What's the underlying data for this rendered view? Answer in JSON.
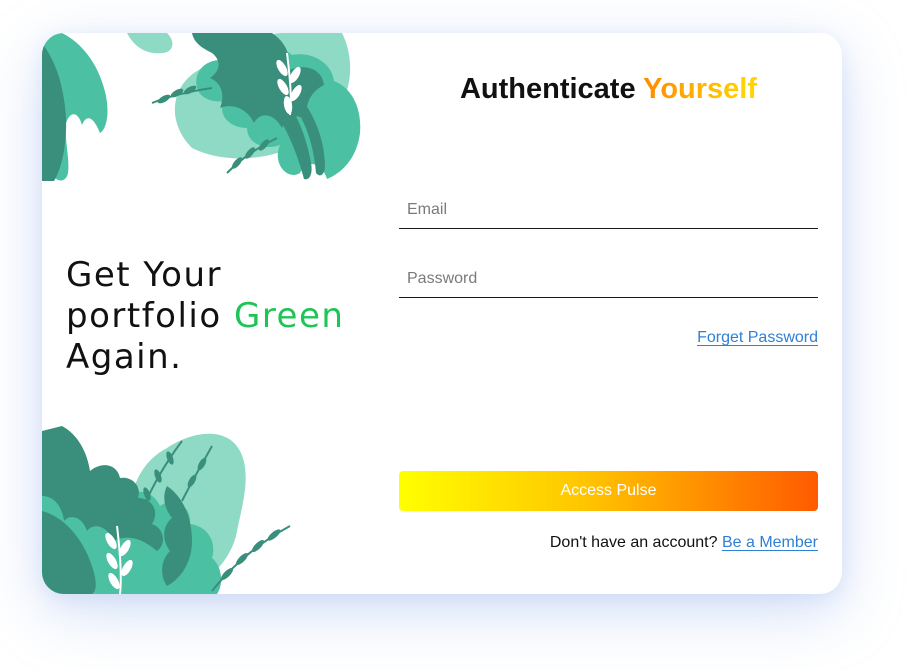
{
  "login": {
    "tagline": {
      "line1": "Get Your",
      "line2_prefix": "portfolio ",
      "line2_accent": "Green",
      "line3": "Again."
    },
    "title_prefix": "Authenticate ",
    "title_accent": "Yourself",
    "email_placeholder": "Email",
    "password_placeholder": "Password",
    "forgot_label": "Forget Password",
    "submit_label": "Access Pulse",
    "signup_prompt": "Don't have an account?",
    "signup_link": "Be a Member"
  },
  "colors": {
    "accent_green": "#1ec456",
    "link_blue": "#2f7fd6",
    "title_gradient": [
      "#ff8a00",
      "#ffd400"
    ],
    "button_gradient": [
      "#ffff00",
      "#ffc400",
      "#ff5a00"
    ],
    "leaf_dark": "#3a8f7c",
    "leaf_mid": "#4cc0a2",
    "leaf_light": "#8fdac4"
  }
}
